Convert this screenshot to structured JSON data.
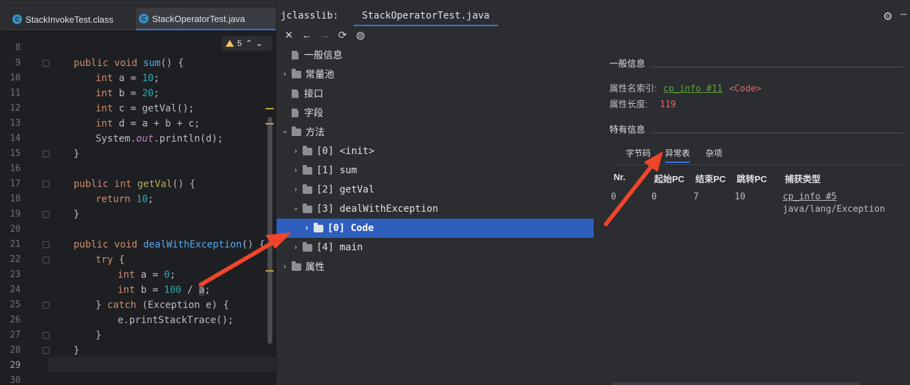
{
  "editor": {
    "tabs": [
      {
        "label": "StackInvokeTest.class",
        "icon": "class-file-icon"
      },
      {
        "label": "StackOperatorTest.java",
        "icon": "class-file-icon",
        "active": true
      }
    ],
    "warnings": {
      "count": "5"
    },
    "lines": [
      {
        "n": "8"
      },
      {
        "n": "9"
      },
      {
        "n": "10"
      },
      {
        "n": "11"
      },
      {
        "n": "12"
      },
      {
        "n": "13"
      },
      {
        "n": "14"
      },
      {
        "n": "15"
      },
      {
        "n": "16"
      },
      {
        "n": "17"
      },
      {
        "n": "18"
      },
      {
        "n": "19"
      },
      {
        "n": "20"
      },
      {
        "n": "21"
      },
      {
        "n": "22"
      },
      {
        "n": "23"
      },
      {
        "n": "24"
      },
      {
        "n": "25"
      },
      {
        "n": "26"
      },
      {
        "n": "27"
      },
      {
        "n": "28"
      },
      {
        "n": "29"
      },
      {
        "n": "30"
      }
    ],
    "code": {
      "l9": [
        "public",
        "void",
        "sum",
        "() {"
      ],
      "l10": [
        "int",
        "a = ",
        "10",
        ";"
      ],
      "l11": [
        "int",
        "b = ",
        "20",
        ";"
      ],
      "l12": [
        "int",
        "c = getVal();"
      ],
      "l13": [
        "int",
        "d = a + b + c;"
      ],
      "l14": [
        "System.",
        "out",
        ".println(d);"
      ],
      "l15": [
        "}"
      ],
      "l17": [
        "public",
        "int",
        "getVal",
        "() {"
      ],
      "l18": [
        "return",
        "10",
        ";"
      ],
      "l19": [
        "}"
      ],
      "l21": [
        "public",
        "void",
        "dealWithException",
        "() {"
      ],
      "l22": [
        "try",
        "{"
      ],
      "l23": [
        "int",
        "a = ",
        "0",
        ";"
      ],
      "l24": [
        "int",
        "b = ",
        "100",
        " / ",
        "a",
        ";"
      ],
      "l25": [
        "}",
        "catch",
        "(Exception e) {"
      ],
      "l26": [
        "e.printStackTrace();"
      ],
      "l27": [
        "}"
      ],
      "l28": [
        "}"
      ]
    }
  },
  "jclasslib": {
    "title": "jclasslib:",
    "tab": "StackOperatorTest.java",
    "tree": {
      "general": "一般信息",
      "constant_pool": "常量池",
      "interfaces": "接口",
      "fields": "字段",
      "methods": "方法",
      "m0": "[0] <init>",
      "m1": "[1] sum",
      "m2": "[2] getVal",
      "m3": "[3] dealWithException",
      "m3_code": "[0] Code",
      "m4": "[4] main",
      "attributes": "属性"
    },
    "detail": {
      "general_title": "一般信息",
      "name_index_label": "属性名索引:",
      "name_index_link": "cp_info #11",
      "name_index_value": "<Code>",
      "length_label": "属性长度:",
      "length_value": "119",
      "specific_title": "特有信息",
      "tabs": [
        "字节码",
        "异常表",
        "杂项"
      ],
      "table": {
        "headers": [
          "Nr.",
          "起始PC",
          "结束PC",
          "跳转PC",
          "捕获类型"
        ],
        "row": {
          "nr": "0",
          "start": "0",
          "end": "7",
          "handler": "10",
          "type_link": "cp_info #5",
          "type_name": "java/lang/Exception"
        }
      }
    }
  },
  "colors": {
    "accent": "#3574f0",
    "selection": "#2e5fbf",
    "arrow": "#f0452a",
    "link": "#5ea339",
    "error": "#e06c6c"
  }
}
